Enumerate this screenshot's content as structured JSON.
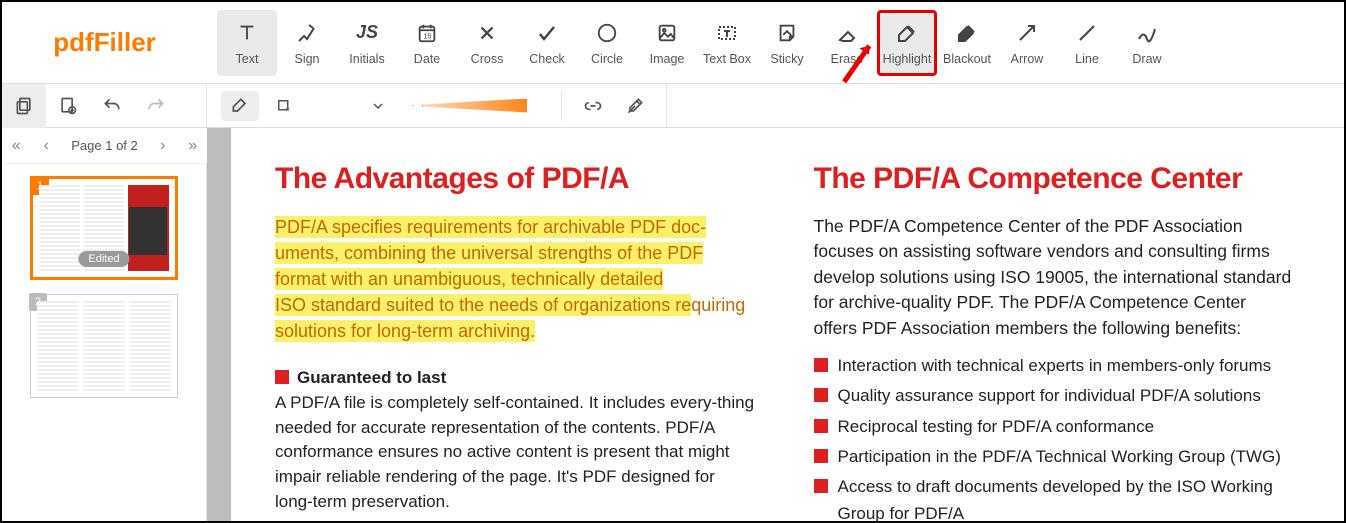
{
  "logo_text": "pdfFiller",
  "toolbar": {
    "tools": [
      {
        "id": "text",
        "label": "Text"
      },
      {
        "id": "sign",
        "label": "Sign"
      },
      {
        "id": "initials",
        "label": "Initials"
      },
      {
        "id": "date",
        "label": "Date"
      },
      {
        "id": "cross",
        "label": "Cross"
      },
      {
        "id": "check",
        "label": "Check"
      },
      {
        "id": "circle",
        "label": "Circle"
      },
      {
        "id": "image",
        "label": "Image"
      },
      {
        "id": "textbox",
        "label": "Text Box"
      },
      {
        "id": "sticky",
        "label": "Sticky"
      },
      {
        "id": "erase",
        "label": "Erase"
      },
      {
        "id": "highlight",
        "label": "Highlight"
      },
      {
        "id": "blackout",
        "label": "Blackout"
      },
      {
        "id": "arrow",
        "label": "Arrow"
      },
      {
        "id": "line",
        "label": "Line"
      },
      {
        "id": "draw",
        "label": "Draw"
      }
    ],
    "active_tool": "highlight"
  },
  "pagenav": {
    "label": "Page 1 of 2"
  },
  "thumbs": [
    {
      "num": "1",
      "selected": true,
      "badge": "Edited"
    },
    {
      "num": "2",
      "selected": false
    }
  ],
  "document": {
    "left": {
      "title": "The Advantages of PDF/A",
      "intro": "PDF/A specifies requirements for archivable PDF doc-uments, combining the universal strengths of the PDF format with an unambiguous, technically detailed ISO standard suited to the needs of organizations requiring solutions for long-term archiving.",
      "section_title": "Guaranteed to last",
      "section_body": "A PDF/A file is completely self-contained. It includes every-thing needed for accurate representation of the contents. PDF/A conformance ensures no active content is present that might impair reliable rendering of the page. It's PDF designed for long-term preservation."
    },
    "right": {
      "title": "The PDF/A Competence Center",
      "intro": "The PDF/A Competence Center of the PDF Association focuses on assisting software vendors and consulting firms develop solutions using ISO 19005, the international standard for archive-quality PDF. The PDF/A Competence Center offers PDF Association members the following benefits:",
      "bullets": [
        "Interaction with technical experts in members-only forums",
        "Quality assurance support for individual PDF/A solutions",
        "Reciprocal testing for PDF/A conformance",
        "Participation in the PDF/A Technical Working Group (TWG)",
        "Access to draft documents developed by the ISO Working Group for PDF/A"
      ]
    }
  }
}
